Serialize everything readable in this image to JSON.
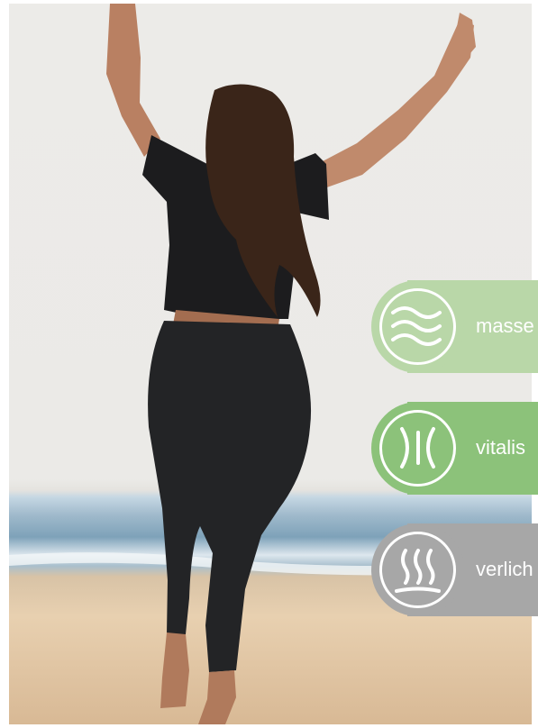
{
  "photo": {
    "subject": "woman dancing on beach"
  },
  "badges": [
    {
      "label": "masse",
      "icon": "waves-icon",
      "color": "#b9d7a8"
    },
    {
      "label": "vitalis",
      "icon": "energy-icon",
      "color": "#8cc27a"
    },
    {
      "label": "verlich",
      "icon": "heat-icon",
      "color": "#a7a7a7"
    }
  ]
}
